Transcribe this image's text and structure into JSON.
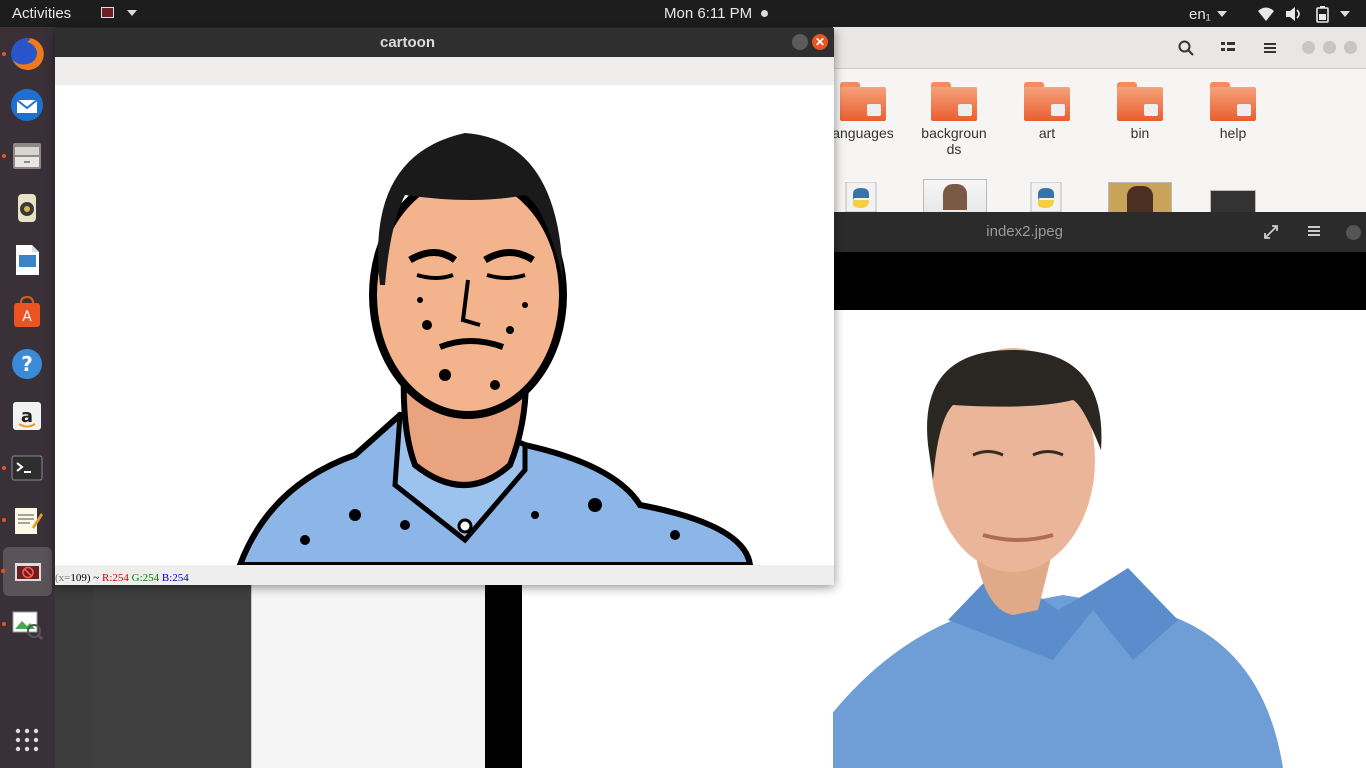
{
  "topbar": {
    "activities": "Activities",
    "clock": "Mon  6:11 PM",
    "language": "en₁"
  },
  "dock": {
    "items": [
      "firefox-icon",
      "thunderbird-icon",
      "files-icon",
      "rhythmbox-icon",
      "libreoffice-impress-icon",
      "software-center-icon",
      "help-icon",
      "amazon-icon",
      "terminal-icon",
      "text-editor-icon",
      "opencv-window-icon",
      "image-viewer-icon",
      "show-applications-icon"
    ]
  },
  "filemanager": {
    "folders": [
      "anguages",
      "backgrounds",
      "art",
      "bin",
      "help"
    ]
  },
  "viewer": {
    "title": "index2.jpeg"
  },
  "cartoon": {
    "title": "cartoon",
    "status_prefix": "(x=",
    "status_coord": "109) ~",
    "status_r": "R:254",
    "status_g": "G:254",
    "status_b": "B:254"
  },
  "colors": {
    "ubuntu_orange": "#e95420",
    "dock_bg": "#3a3138",
    "topbar_bg": "#1d1d1d"
  }
}
